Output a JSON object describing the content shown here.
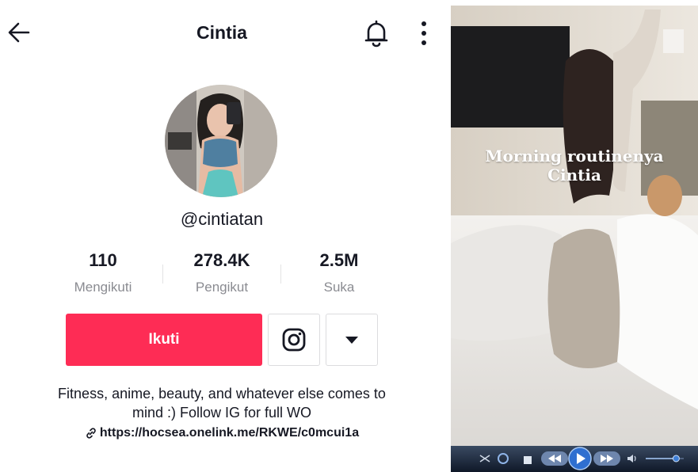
{
  "header": {
    "title": "Cintia"
  },
  "profile": {
    "handle": "@cintiatan",
    "stats": [
      {
        "value": "110",
        "label": "Mengikuti"
      },
      {
        "value": "278.4K",
        "label": "Pengikut"
      },
      {
        "value": "2.5M",
        "label": "Suka"
      }
    ],
    "follow_label": "Ikuti",
    "bio_line1": "Fitness, anime, beauty, and whatever else comes to",
    "bio_line2": "mind :) Follow IG for full WO",
    "link": "https://hocsea.onelink.me/RKWE/c0mcui1a"
  },
  "video": {
    "caption_line1": "Morning routinenya",
    "caption_line2": "Cintia",
    "volume_level": 0.8
  },
  "colors": {
    "accent": "#fe2c55",
    "muted_text": "#8a8b91"
  }
}
